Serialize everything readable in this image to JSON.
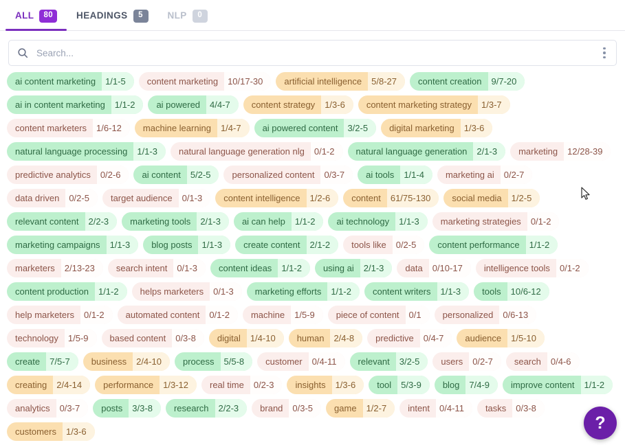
{
  "tabs": [
    {
      "label": "ALL",
      "badge": "80",
      "state": "active",
      "name": "tab-all"
    },
    {
      "label": "HEADINGS",
      "badge": "5",
      "state": "idle",
      "name": "tab-headings"
    },
    {
      "label": "NLP",
      "badge": "0",
      "state": "muted",
      "name": "tab-nlp"
    }
  ],
  "search": {
    "placeholder": "Search...",
    "value": "",
    "icon": "search-icon",
    "menu_icon": "kebab-menu-icon"
  },
  "help": {
    "label": "?",
    "icon": "help-question-icon"
  },
  "colors": {
    "accent_purple": "#7b2fbe",
    "badge_active": "#8f2ed6",
    "badge_idle": "#7b8499",
    "badge_muted": "#cfd4de",
    "tag_green": "#bdf0cd",
    "tag_green_count": "#e4fbeb",
    "tag_amber": "#fbdfb0",
    "tag_amber_count": "#fdf3e0",
    "tag_neutral": "#fbeeec",
    "tag_neutral_count": "#fffdfc",
    "help_fab": "#6b1fa8"
  },
  "tags": [
    {
      "label": "ai content marketing",
      "count": "1/1-5",
      "variant": "green"
    },
    {
      "label": "content marketing",
      "count": "10/17-30",
      "variant": "neutral"
    },
    {
      "label": "artificial intelligence",
      "count": "5/8-27",
      "variant": "amber"
    },
    {
      "label": "content creation",
      "count": "9/7-20",
      "variant": "green"
    },
    {
      "label": "ai in content marketing",
      "count": "1/1-2",
      "variant": "green"
    },
    {
      "label": "ai powered",
      "count": "4/4-7",
      "variant": "green"
    },
    {
      "label": "content strategy",
      "count": "1/3-6",
      "variant": "amber"
    },
    {
      "label": "content marketing strategy",
      "count": "1/3-7",
      "variant": "amber"
    },
    {
      "label": "content marketers",
      "count": "1/6-12",
      "variant": "neutral"
    },
    {
      "label": "machine learning",
      "count": "1/4-7",
      "variant": "amber"
    },
    {
      "label": "ai powered content",
      "count": "3/2-5",
      "variant": "green"
    },
    {
      "label": "digital marketing",
      "count": "1/3-6",
      "variant": "amber"
    },
    {
      "label": "natural language processing",
      "count": "1/1-3",
      "variant": "green"
    },
    {
      "label": "natural language generation nlg",
      "count": "0/1-2",
      "variant": "neutral"
    },
    {
      "label": "natural language generation",
      "count": "2/1-3",
      "variant": "green"
    },
    {
      "label": "marketing",
      "count": "12/28-39",
      "variant": "neutral"
    },
    {
      "label": "predictive analytics",
      "count": "0/2-6",
      "variant": "neutral"
    },
    {
      "label": "ai content",
      "count": "5/2-5",
      "variant": "green"
    },
    {
      "label": "personalized content",
      "count": "0/3-7",
      "variant": "neutral"
    },
    {
      "label": "ai tools",
      "count": "1/1-4",
      "variant": "green"
    },
    {
      "label": "marketing ai",
      "count": "0/2-7",
      "variant": "neutral"
    },
    {
      "label": "data driven",
      "count": "0/2-5",
      "variant": "neutral"
    },
    {
      "label": "target audience",
      "count": "0/1-3",
      "variant": "neutral"
    },
    {
      "label": "content intelligence",
      "count": "1/2-6",
      "variant": "amber"
    },
    {
      "label": "content",
      "count": "61/75-130",
      "variant": "amber"
    },
    {
      "label": "social media",
      "count": "1/2-5",
      "variant": "amber"
    },
    {
      "label": "relevant content",
      "count": "2/2-3",
      "variant": "green"
    },
    {
      "label": "marketing tools",
      "count": "2/1-3",
      "variant": "green"
    },
    {
      "label": "ai can help",
      "count": "1/1-2",
      "variant": "green"
    },
    {
      "label": "ai technology",
      "count": "1/1-3",
      "variant": "green"
    },
    {
      "label": "marketing strategies",
      "count": "0/1-2",
      "variant": "neutral"
    },
    {
      "label": "marketing campaigns",
      "count": "1/1-3",
      "variant": "green"
    },
    {
      "label": "blog posts",
      "count": "1/1-3",
      "variant": "green"
    },
    {
      "label": "create content",
      "count": "2/1-2",
      "variant": "green"
    },
    {
      "label": "tools like",
      "count": "0/2-5",
      "variant": "neutral"
    },
    {
      "label": "content performance",
      "count": "1/1-2",
      "variant": "green"
    },
    {
      "label": "marketers",
      "count": "2/13-23",
      "variant": "neutral"
    },
    {
      "label": "search intent",
      "count": "0/1-3",
      "variant": "neutral"
    },
    {
      "label": "content ideas",
      "count": "1/1-2",
      "variant": "green"
    },
    {
      "label": "using ai",
      "count": "2/1-3",
      "variant": "green"
    },
    {
      "label": "data",
      "count": "0/10-17",
      "variant": "neutral"
    },
    {
      "label": "intelligence tools",
      "count": "0/1-2",
      "variant": "neutral"
    },
    {
      "label": "content production",
      "count": "1/1-2",
      "variant": "green"
    },
    {
      "label": "helps marketers",
      "count": "0/1-3",
      "variant": "neutral"
    },
    {
      "label": "marketing efforts",
      "count": "1/1-2",
      "variant": "green"
    },
    {
      "label": "content writers",
      "count": "1/1-3",
      "variant": "green"
    },
    {
      "label": "tools",
      "count": "10/6-12",
      "variant": "green"
    },
    {
      "label": "help marketers",
      "count": "0/1-2",
      "variant": "neutral"
    },
    {
      "label": "automated content",
      "count": "0/1-2",
      "variant": "neutral"
    },
    {
      "label": "machine",
      "count": "1/5-9",
      "variant": "neutral"
    },
    {
      "label": "piece of content",
      "count": "0/1",
      "variant": "neutral"
    },
    {
      "label": "personalized",
      "count": "0/6-13",
      "variant": "neutral"
    },
    {
      "label": "technology",
      "count": "1/5-9",
      "variant": "neutral"
    },
    {
      "label": "based content",
      "count": "0/3-8",
      "variant": "neutral"
    },
    {
      "label": "digital",
      "count": "1/4-10",
      "variant": "amber"
    },
    {
      "label": "human",
      "count": "2/4-8",
      "variant": "amber"
    },
    {
      "label": "predictive",
      "count": "0/4-7",
      "variant": "neutral"
    },
    {
      "label": "audience",
      "count": "1/5-10",
      "variant": "amber"
    },
    {
      "label": "create",
      "count": "7/5-7",
      "variant": "green"
    },
    {
      "label": "business",
      "count": "2/4-10",
      "variant": "amber"
    },
    {
      "label": "process",
      "count": "5/5-8",
      "variant": "green"
    },
    {
      "label": "customer",
      "count": "0/4-11",
      "variant": "neutral"
    },
    {
      "label": "relevant",
      "count": "3/2-5",
      "variant": "green"
    },
    {
      "label": "users",
      "count": "0/2-7",
      "variant": "neutral"
    },
    {
      "label": "search",
      "count": "0/4-6",
      "variant": "neutral"
    },
    {
      "label": "creating",
      "count": "2/4-14",
      "variant": "amber"
    },
    {
      "label": "performance",
      "count": "1/3-12",
      "variant": "amber"
    },
    {
      "label": "real time",
      "count": "0/2-3",
      "variant": "neutral"
    },
    {
      "label": "insights",
      "count": "1/3-6",
      "variant": "amber"
    },
    {
      "label": "tool",
      "count": "5/3-9",
      "variant": "green"
    },
    {
      "label": "blog",
      "count": "7/4-9",
      "variant": "green"
    },
    {
      "label": "improve content",
      "count": "1/1-2",
      "variant": "green"
    },
    {
      "label": "analytics",
      "count": "0/3-7",
      "variant": "neutral"
    },
    {
      "label": "posts",
      "count": "3/3-8",
      "variant": "green"
    },
    {
      "label": "research",
      "count": "2/2-3",
      "variant": "green"
    },
    {
      "label": "brand",
      "count": "0/3-5",
      "variant": "neutral"
    },
    {
      "label": "game",
      "count": "1/2-7",
      "variant": "amber"
    },
    {
      "label": "intent",
      "count": "0/4-11",
      "variant": "neutral"
    },
    {
      "label": "tasks",
      "count": "0/3-8",
      "variant": "neutral"
    },
    {
      "label": "customers",
      "count": "1/3-6",
      "variant": "amber"
    }
  ]
}
